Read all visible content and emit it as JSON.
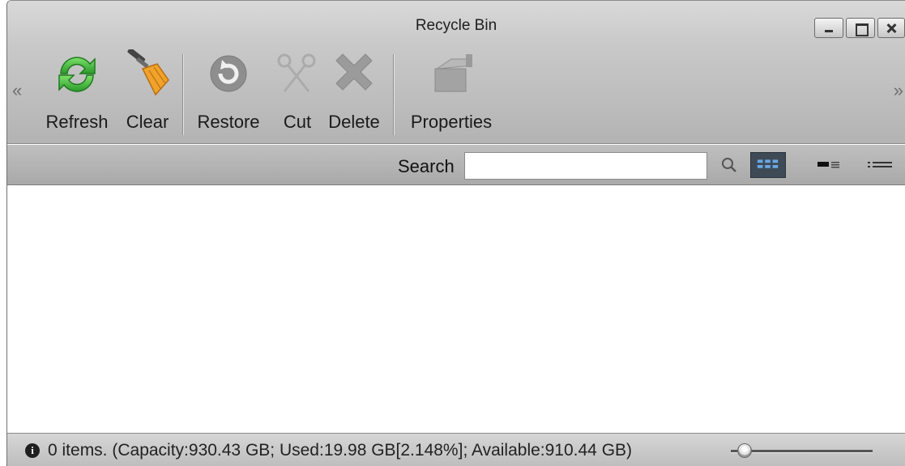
{
  "window": {
    "title": "Recycle Bin"
  },
  "toolbar": {
    "refresh_label": "Refresh",
    "clear_label": "Clear",
    "restore_label": "Restore",
    "cut_label": "Cut",
    "delete_label": "Delete",
    "properties_label": "Properties",
    "scroll_left": "«",
    "scroll_right": "»"
  },
  "search": {
    "label": "Search",
    "value": "",
    "placeholder": ""
  },
  "view_modes": {
    "selected": "grid",
    "options": [
      "grid",
      "detail",
      "list"
    ]
  },
  "status": {
    "text": "0 items. (Capacity:930.43 GB; Used:19.98 GB[2.148%]; Available:910.44 GB)",
    "zoom_level": 0.05
  },
  "colors": {
    "refresh_green": "#3fb53a",
    "clear_orange": "#f0a22a",
    "selected_view_bg": "#3e4a55",
    "disabled_icon": "#9e9e9e"
  }
}
